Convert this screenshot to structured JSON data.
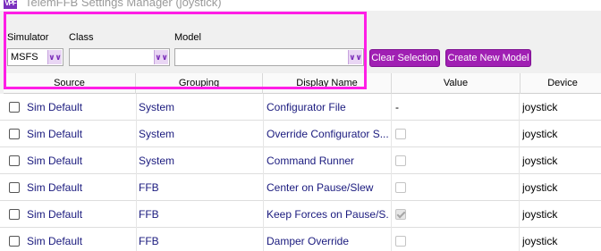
{
  "window": {
    "title": "TelemFFB Settings Manager (joystick)",
    "icon_text": "VPF",
    "icon": "app-logo-icon"
  },
  "filters": {
    "simulator": {
      "label": "Simulator",
      "value": "MSFS"
    },
    "class": {
      "label": "Class",
      "value": ""
    },
    "model": {
      "label": "Model",
      "value": ""
    }
  },
  "toolbar": {
    "clear_selection": "Clear Selection",
    "create_new_model": "Create New Model"
  },
  "table": {
    "columns": [
      "Source",
      "Grouping",
      "Display Name",
      "Value",
      "Device"
    ],
    "rows": [
      {
        "source": "Sim Default",
        "grouping": "System",
        "display_name": "Configurator File",
        "value_text": "-",
        "value_checkbox": null,
        "device": "joystick"
      },
      {
        "source": "Sim Default",
        "grouping": "System",
        "display_name": "Override Configurator S...",
        "value_text": "",
        "value_checkbox": false,
        "device": "joystick"
      },
      {
        "source": "Sim Default",
        "grouping": "System",
        "display_name": "Command Runner",
        "value_text": "",
        "value_checkbox": false,
        "device": "joystick"
      },
      {
        "source": "Sim Default",
        "grouping": "FFB",
        "display_name": "Center on Pause/Slew",
        "value_text": "",
        "value_checkbox": false,
        "device": "joystick"
      },
      {
        "source": "Sim Default",
        "grouping": "FFB",
        "display_name": "Keep Forces on Pause/S...",
        "value_text": "",
        "value_checkbox": true,
        "device": "joystick"
      },
      {
        "source": "Sim Default",
        "grouping": "FFB",
        "display_name": "Damper Override",
        "value_text": "",
        "value_checkbox": false,
        "device": "joystick"
      }
    ]
  },
  "colors": {
    "accent": "#a01fb3",
    "highlight": "#ff1ee6",
    "link_text": "#1a1a7e"
  }
}
